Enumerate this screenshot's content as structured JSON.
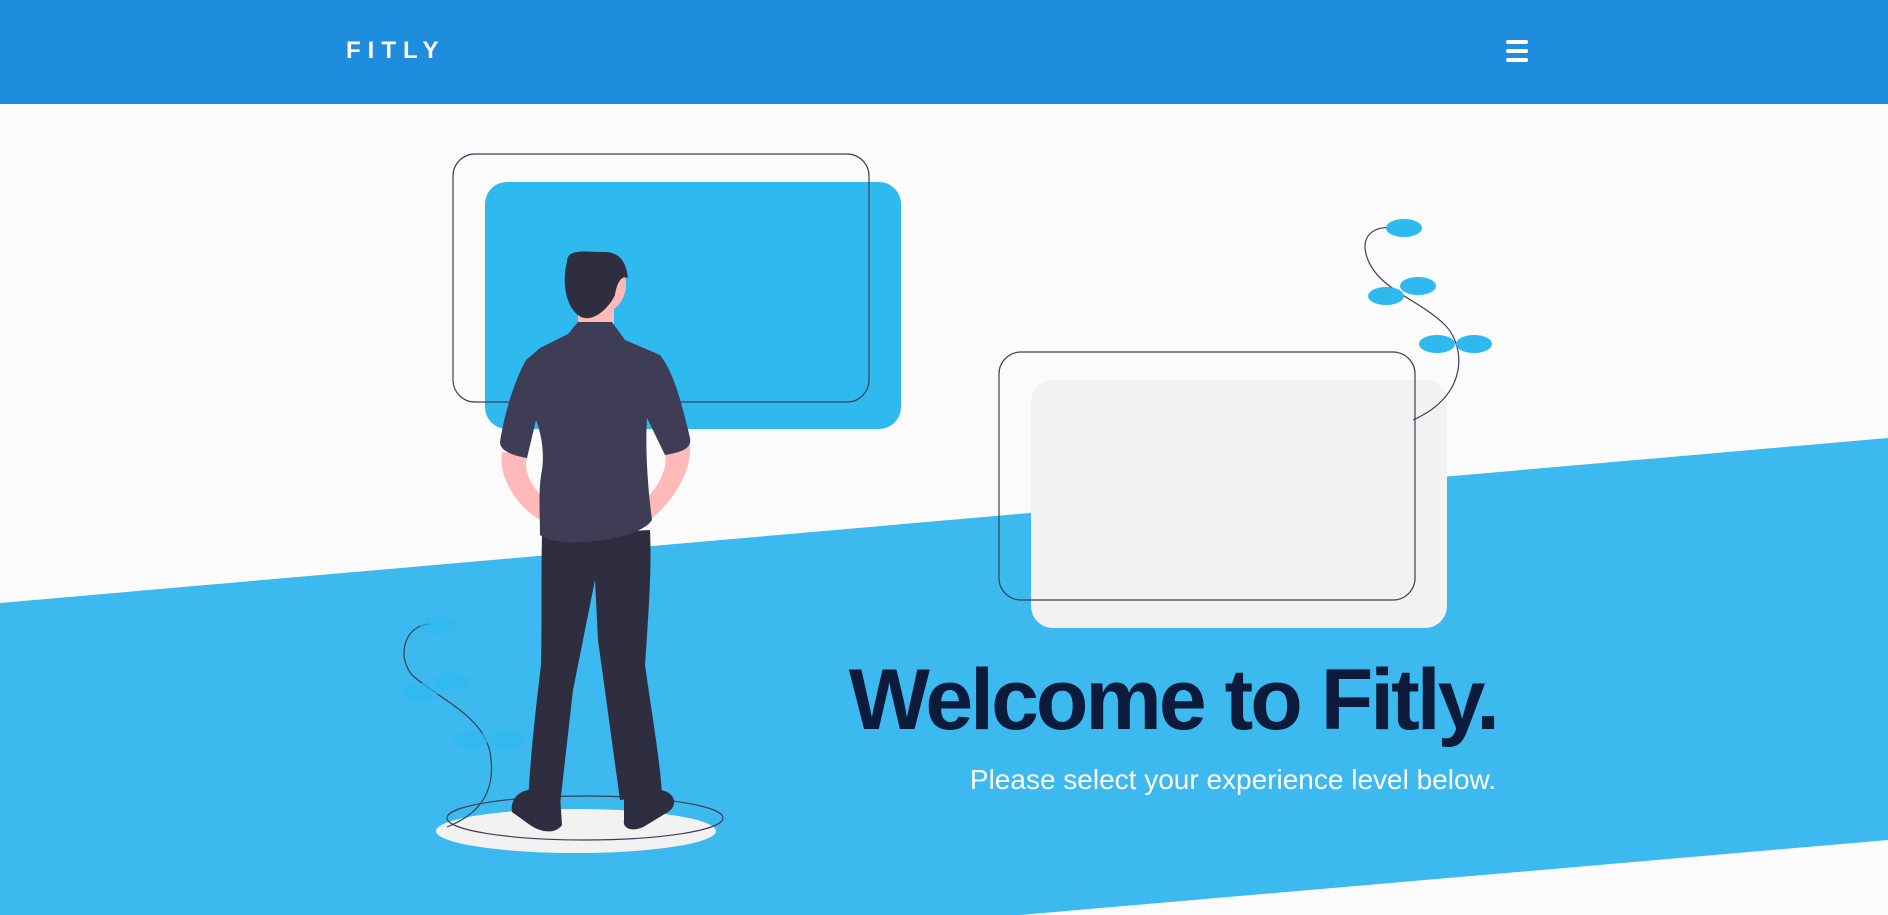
{
  "navbar": {
    "brand": "FITLY",
    "menu_icon": "hamburger-menu-icon"
  },
  "hero": {
    "title": "Welcome to Fitly.",
    "subtitle": "Please select your experience level below.",
    "illustration": "person-viewing-screens-illustration"
  },
  "colors": {
    "navbar_bg": "#1e8ddd",
    "hero_band": "#3cb9ee",
    "screen_blue": "#2ebaee",
    "title_text": "#0c1b3b",
    "page_bg": "#fbfbfb"
  }
}
